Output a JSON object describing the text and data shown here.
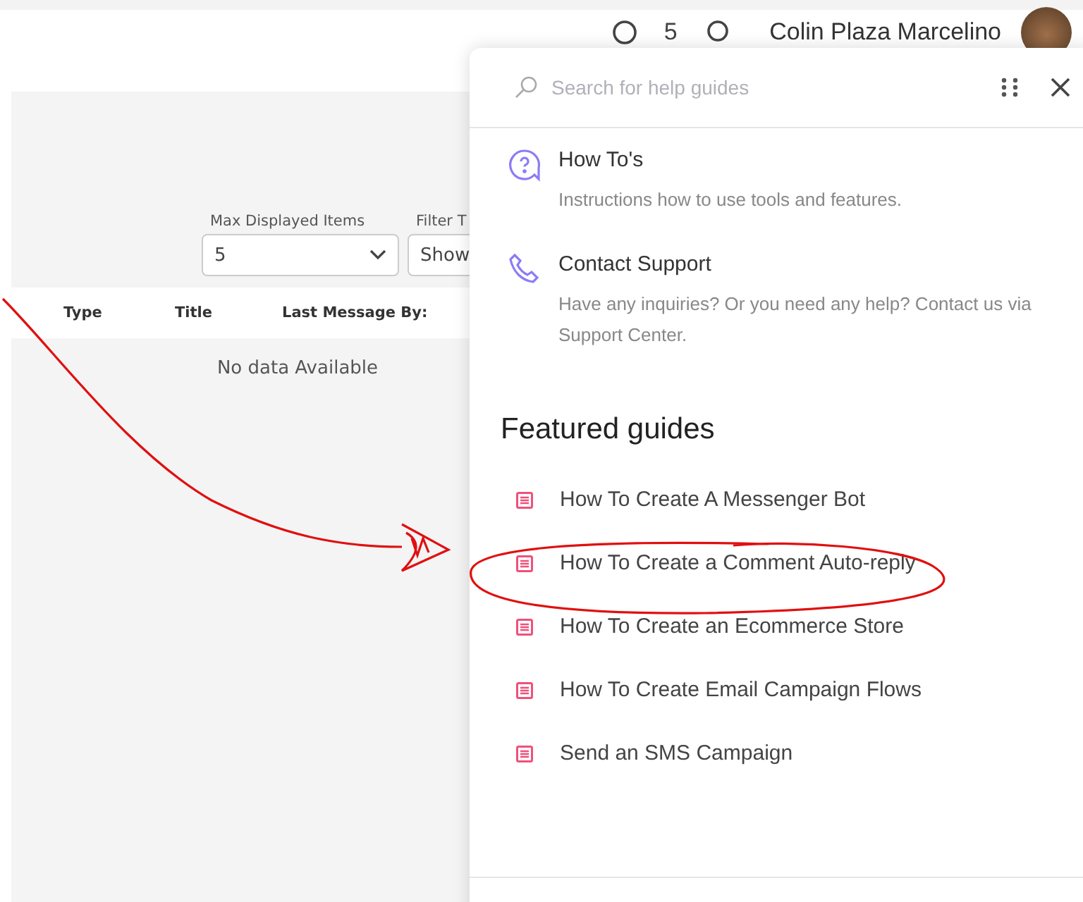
{
  "header": {
    "badge": "5",
    "user_name": "Colin Plaza Marcelino"
  },
  "filters": [
    {
      "label": "Max Displayed Items",
      "value": "5",
      "kind": "select"
    },
    {
      "label": "Filter T",
      "value": "Show",
      "kind": "field"
    }
  ],
  "table": {
    "columns": [
      "Type",
      "Title",
      "Last Message By:"
    ],
    "empty_text": "No data Available"
  },
  "help_panel": {
    "search": {
      "placeholder": "Search for help guides"
    },
    "sections": [
      {
        "kind": "question",
        "title": "How To's",
        "description": "Instructions how to use tools and features."
      },
      {
        "kind": "phone",
        "title": "Contact Support",
        "description": "Have any inquiries? Or you need any help? Contact us via Support Center."
      }
    ],
    "featured_title": "Featured guides",
    "guides": [
      "How To Create A Messenger Bot",
      "How To Create a Comment Auto-reply",
      "How To Create an Ecommerce Store",
      "How To Create Email Campaign Flows",
      "Send an SMS Campaign"
    ]
  }
}
